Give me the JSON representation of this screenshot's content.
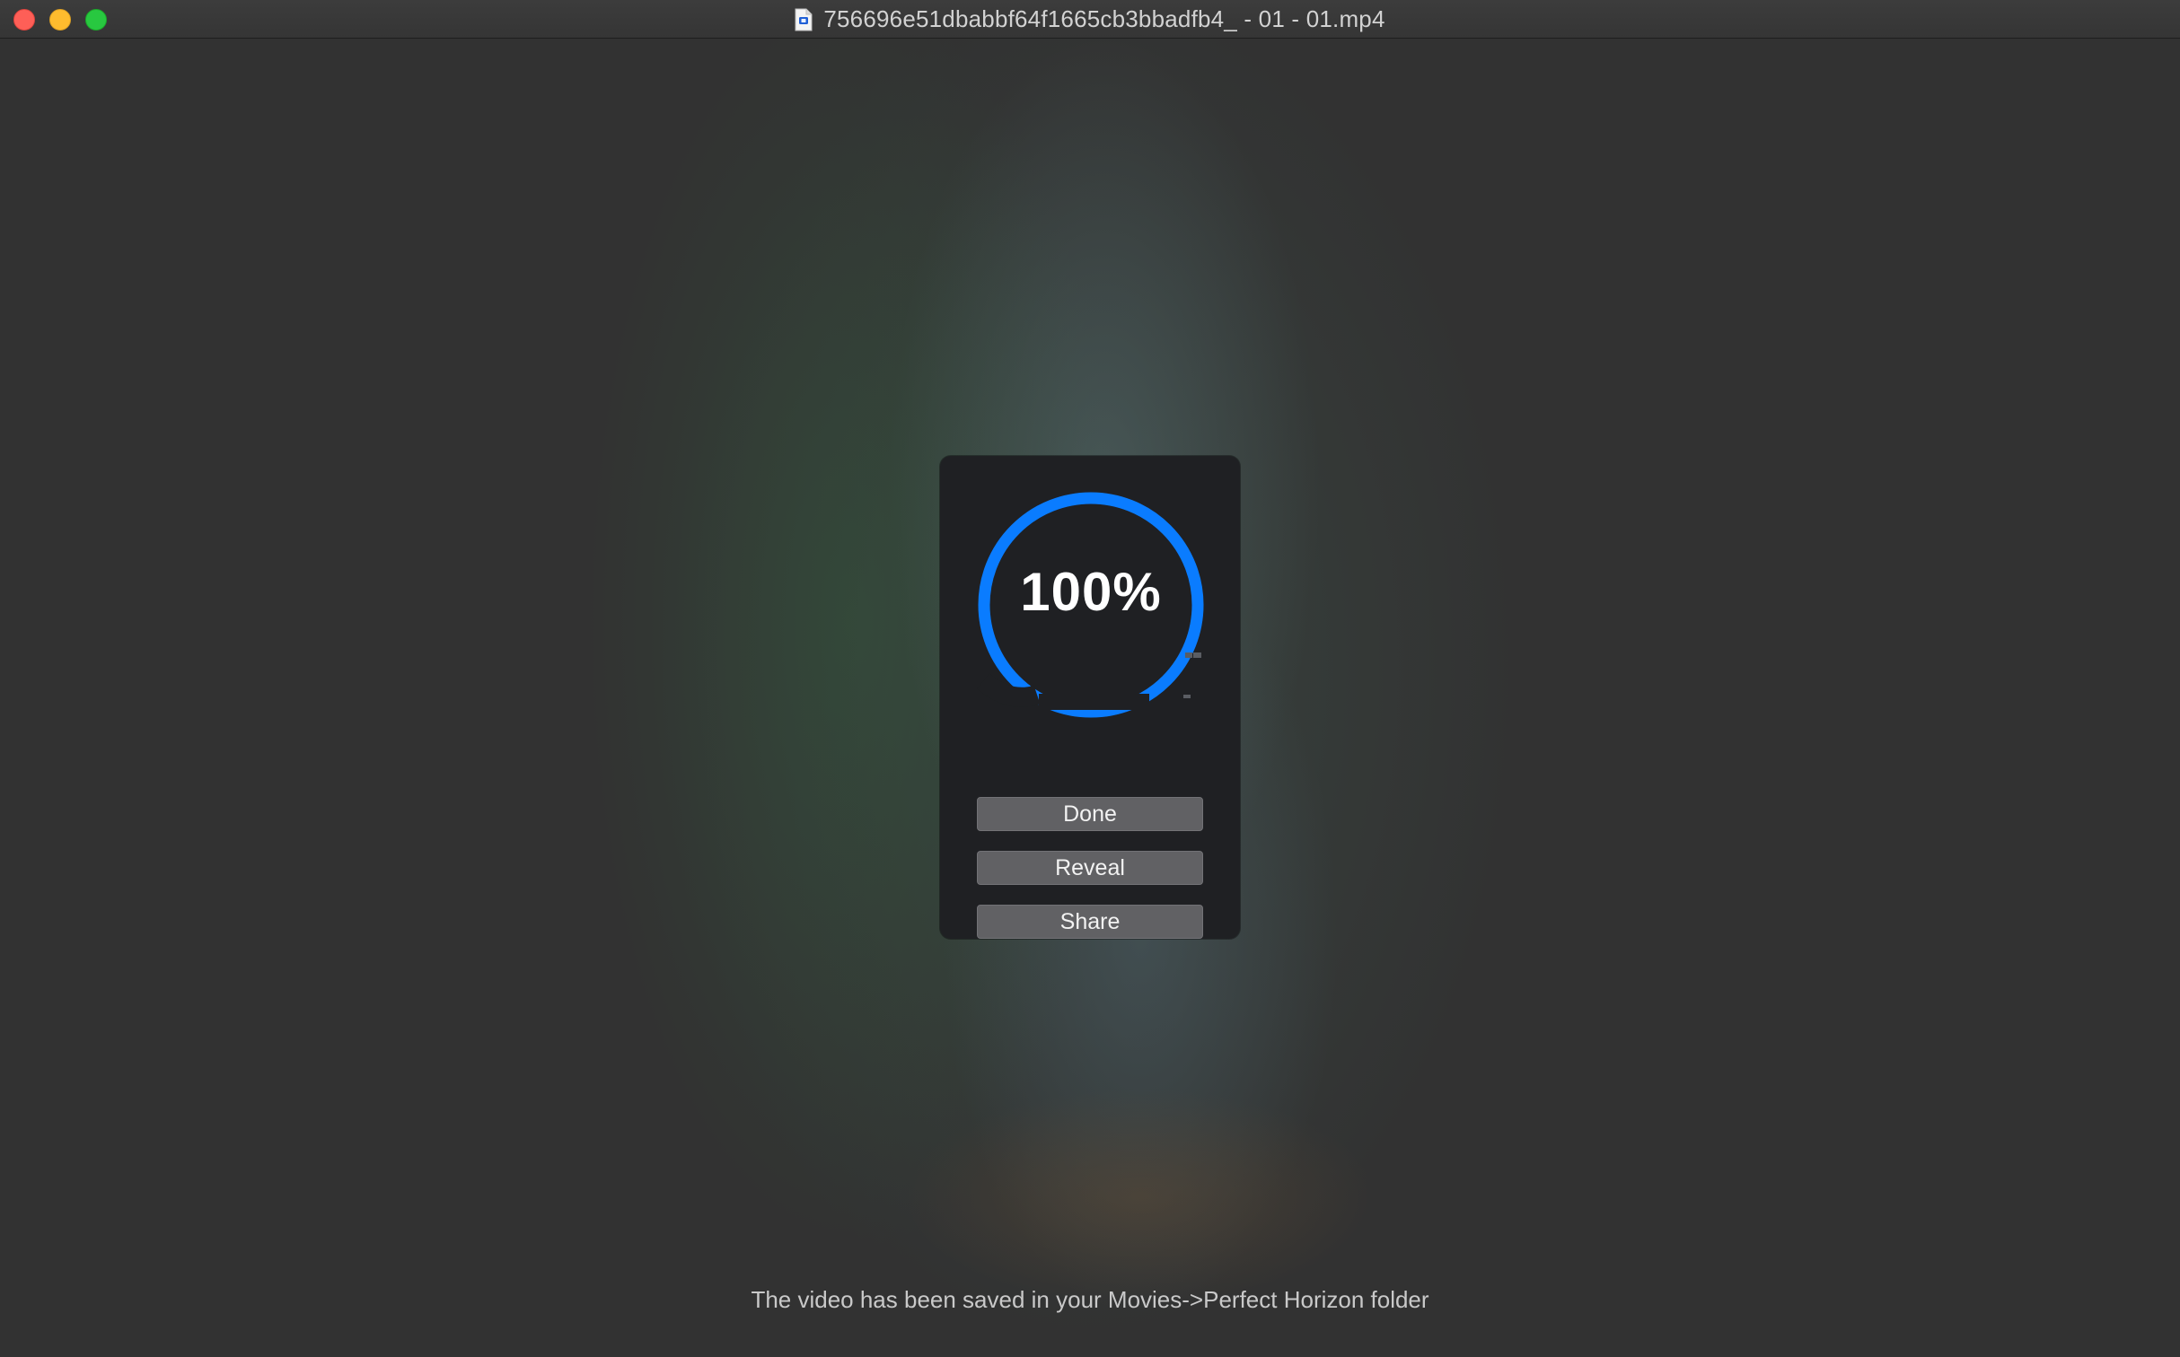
{
  "window": {
    "title": "756696e51dbabbf64f1665cb3bbadfb4_ - 01 - 01.mp4",
    "title_icon": "document-icon",
    "controls": [
      "close",
      "minimize",
      "zoom"
    ]
  },
  "export_panel": {
    "progress_text": "100%",
    "progress_fraction": 1.0,
    "accent_color": "#0a7cff",
    "buttons": {
      "done": "Done",
      "reveal": "Reveal",
      "share": "Share"
    }
  },
  "status_message": "The video has been saved in your Movies->Perfect Horizon folder"
}
